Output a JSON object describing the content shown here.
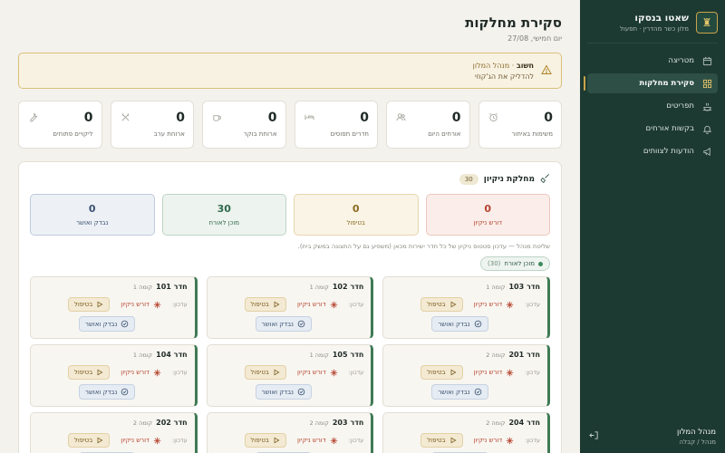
{
  "brand": {
    "title": "שאטו בנסקו",
    "subtitle": "מלון כשר מהדרין · תפעול",
    "logo_icon": "bell-icon"
  },
  "nav": [
    {
      "label": "מטריצה",
      "icon": "calendar-icon",
      "active": false
    },
    {
      "label": "סקירת מחלקות",
      "icon": "grid-icon",
      "active": true
    },
    {
      "label": "תפריטים",
      "icon": "dining-icon",
      "active": false
    },
    {
      "label": "בקשות אורחים",
      "icon": "bell-outline-icon",
      "active": false
    },
    {
      "label": "הודעות לצוותים",
      "icon": "megaphone-icon",
      "active": false
    }
  ],
  "user": {
    "name": "מנהל המלון",
    "role": "מנהל / קבלה"
  },
  "page": {
    "title": "סקירת מחלקות",
    "date": "יום חמישי, 27/08"
  },
  "alert": {
    "bold": "חשוב",
    "rest": " · מנהל המלון",
    "line2": "להדליק את הג'קוזי"
  },
  "stats": [
    {
      "value": "0",
      "label": "משימות באיחור",
      "icon": "alarm-icon"
    },
    {
      "value": "0",
      "label": "אורחים היום",
      "icon": "users-icon"
    },
    {
      "value": "0",
      "label": "חדרים תפוסים",
      "icon": "bed-icon"
    },
    {
      "value": "0",
      "label": "ארוחת בוקר",
      "icon": "coffee-icon"
    },
    {
      "value": "0",
      "label": "ארוחת ערב",
      "icon": "utensils-icon"
    },
    {
      "value": "0",
      "label": "ליקויים פתוחים",
      "icon": "wrench-icon"
    }
  ],
  "housekeeping": {
    "title": "מחלקת ניקיון",
    "count": "30",
    "statuses": [
      {
        "value": "0",
        "label": "דורש ניקיון",
        "kind": "dirty"
      },
      {
        "value": "0",
        "label": "בטיפול",
        "kind": "progress"
      },
      {
        "value": "30",
        "label": "מוכן לאורח",
        "kind": "ready"
      },
      {
        "value": "0",
        "label": "נבדק ואושר",
        "kind": "inspected"
      }
    ],
    "hint": "שליטת מנהל — עדכון סטטוס ניקיון של כל חדר ישירות מכאן (משפיע גם על התצוגה במשק בית).",
    "filter": {
      "label": "מוכן לאורח",
      "count": "(30)"
    },
    "labels": {
      "update": "עדכון:",
      "dirty": "דורש ניקיון",
      "progress": "בטיפול",
      "inspected": "נבדק ואושר"
    },
    "rooms": [
      {
        "name": "חדר 101",
        "floor": "קומה 1"
      },
      {
        "name": "חדר 102",
        "floor": "קומה 1"
      },
      {
        "name": "חדר 103",
        "floor": "קומה 1"
      },
      {
        "name": "חדר 104",
        "floor": "קומה 1"
      },
      {
        "name": "חדר 105",
        "floor": "קומה 1"
      },
      {
        "name": "חדר 201",
        "floor": "קומה 2"
      },
      {
        "name": "חדר 202",
        "floor": "קומה 2"
      },
      {
        "name": "חדר 203",
        "floor": "קומה 2"
      },
      {
        "name": "חדר 204",
        "floor": "קומה 2"
      }
    ]
  }
}
